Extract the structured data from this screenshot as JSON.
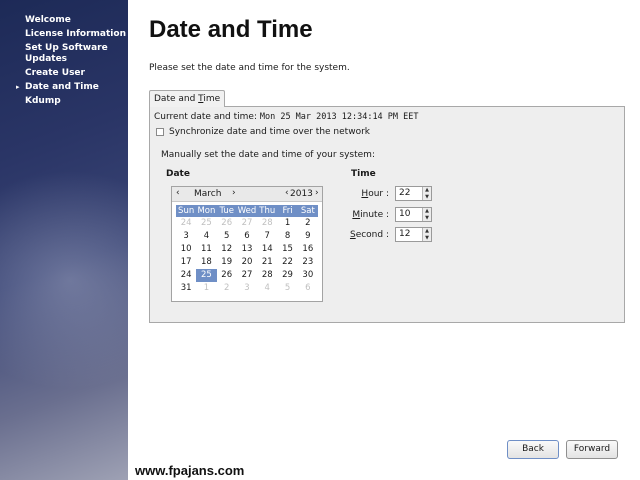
{
  "sidebar": {
    "items": [
      {
        "label": "Welcome"
      },
      {
        "label": "License Information"
      },
      {
        "label": "Set Up Software Updates"
      },
      {
        "label": "Create User"
      },
      {
        "label": "Date and Time",
        "current": true
      },
      {
        "label": "Kdump"
      }
    ],
    "current_marker": "▸"
  },
  "page": {
    "title": "Date and Time",
    "intro": "Please set the date and time for the system."
  },
  "tab": {
    "label_prefix": "Date and ",
    "label_mnemonic": "T",
    "label_suffix": "ime"
  },
  "current": {
    "label": "Current date and time:",
    "value": "Mon 25 Mar 2013 12:34:14 PM EET"
  },
  "sync": {
    "label": "Synchronize date and time over the network",
    "checked": false
  },
  "manual_label": "Manually set the date and time of your system:",
  "date_heading": "Date",
  "time_heading": "Time",
  "calendar": {
    "month": "March",
    "year": "2013",
    "prev": "‹",
    "next": "›",
    "weekdays": [
      "Sun",
      "Mon",
      "Tue",
      "Wed",
      "Thu",
      "Fri",
      "Sat"
    ],
    "selected_day": "25",
    "weeks": [
      [
        {
          "d": "24",
          "dim": true
        },
        {
          "d": "25",
          "dim": true
        },
        {
          "d": "26",
          "dim": true
        },
        {
          "d": "27",
          "dim": true
        },
        {
          "d": "28",
          "dim": true
        },
        {
          "d": "1"
        },
        {
          "d": "2"
        }
      ],
      [
        {
          "d": "3"
        },
        {
          "d": "4"
        },
        {
          "d": "5"
        },
        {
          "d": "6"
        },
        {
          "d": "7"
        },
        {
          "d": "8"
        },
        {
          "d": "9"
        }
      ],
      [
        {
          "d": "10"
        },
        {
          "d": "11"
        },
        {
          "d": "12"
        },
        {
          "d": "13"
        },
        {
          "d": "14"
        },
        {
          "d": "15"
        },
        {
          "d": "16"
        }
      ],
      [
        {
          "d": "17"
        },
        {
          "d": "18"
        },
        {
          "d": "19"
        },
        {
          "d": "20"
        },
        {
          "d": "21"
        },
        {
          "d": "22"
        },
        {
          "d": "23"
        }
      ],
      [
        {
          "d": "24"
        },
        {
          "d": "25",
          "sel": true
        },
        {
          "d": "26"
        },
        {
          "d": "27"
        },
        {
          "d": "28"
        },
        {
          "d": "29"
        },
        {
          "d": "30"
        }
      ],
      [
        {
          "d": "31"
        },
        {
          "d": "1",
          "dim": true
        },
        {
          "d": "2",
          "dim": true
        },
        {
          "d": "3",
          "dim": true
        },
        {
          "d": "4",
          "dim": true
        },
        {
          "d": "5",
          "dim": true
        },
        {
          "d": "6",
          "dim": true
        }
      ]
    ]
  },
  "time": {
    "hour": {
      "label": "Hour :",
      "mnemonic": "H",
      "value": "22"
    },
    "minute": {
      "label": "Minute :",
      "mnemonic": "M",
      "value": "10"
    },
    "second": {
      "label": "Second :",
      "mnemonic": "S",
      "value": "12"
    }
  },
  "buttons": {
    "back": "Back",
    "forward": "Forward"
  },
  "watermark": "www.fpajans.com",
  "colors": {
    "accent": "#6f8fc6",
    "sidebar_top": "#1d2a57",
    "dim_text": "#c0c0c0"
  }
}
